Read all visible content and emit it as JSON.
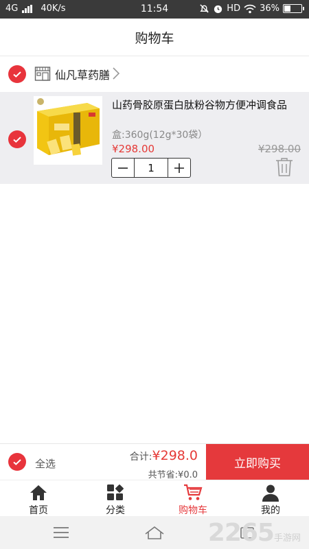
{
  "status_bar": {
    "network": "4G",
    "speed": "40K/s",
    "time": "11:54",
    "hd": "HD",
    "battery": "36%",
    "battery_level": 0.36
  },
  "header": {
    "title": "购物车"
  },
  "store": {
    "name": "仙凡草药膳",
    "checked": true
  },
  "cart_item": {
    "title": "山药骨胶原蛋白肽粉谷物方便冲调食品",
    "spec": "盒:360g(12g*30袋）",
    "price": "¥298.00",
    "original_price": "¥298.00",
    "quantity": "1",
    "checked": true
  },
  "summary": {
    "select_all_label": "全选",
    "total_label": "合计:",
    "total_amount": "¥298.0",
    "saved_label": "共节省:",
    "saved_amount": "¥0.0",
    "buy_button": "立即购买"
  },
  "tabs": [
    {
      "label": "首页",
      "icon": "home-icon",
      "active": false
    },
    {
      "label": "分类",
      "icon": "category-icon",
      "active": false
    },
    {
      "label": "购物车",
      "icon": "cart-icon",
      "active": true
    },
    {
      "label": "我的",
      "icon": "user-icon",
      "active": false
    }
  ],
  "watermark": {
    "number": "2265",
    "suffix": "手游网"
  },
  "colors": {
    "accent": "#e5393c",
    "status_bar": "#3a3a3a",
    "item_bg": "#eeeef1"
  }
}
